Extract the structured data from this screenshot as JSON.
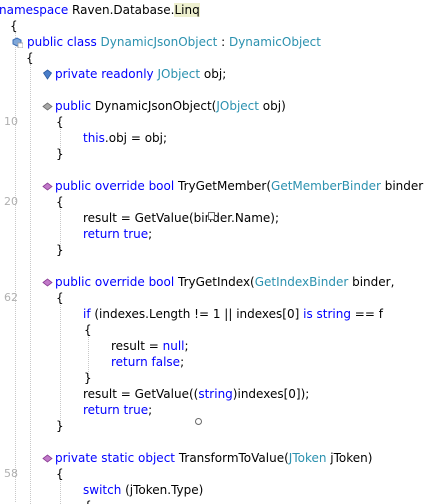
{
  "line_numbers": {
    "ctor": "10",
    "try_get_member": "20",
    "try_get_index": "62",
    "transform": "58"
  },
  "code": {
    "ns_kw": "namespace",
    "ns_name": " Raven.Database.",
    "ns_linq": "Linq",
    "brace_open": "{",
    "brace_close": "}",
    "class_public": "public",
    "class_kw": " class ",
    "class_name": "DynamicJsonObject",
    "class_colon": " : ",
    "class_base": "DynamicObject",
    "field_private": "private",
    "field_readonly": " readonly ",
    "field_type": "JObject",
    "field_name": " obj;",
    "ctor_public": "public",
    "ctor_name": " DynamicJsonObject(",
    "ctor_param_type": "JObject",
    "ctor_param_name": " obj)",
    "ctor_this": "this",
    "ctor_assign": ".obj = obj;",
    "m1_public": "public",
    "m1_override": " override ",
    "m1_bool": "bool",
    "m1_name": " TryGetMember(",
    "m1_param_type": "GetMemberBinder",
    "m1_param_name": " binder",
    "m1_result": "result = GetValue(",
    "m1_binder": "binder.Name);",
    "m1_return": "return",
    "m1_true": " true",
    "semi": ";",
    "m2_public": "public",
    "m2_override": " override ",
    "m2_bool": "bool",
    "m2_name": " TryGetIndex(",
    "m2_param_type": "GetIndexBinder",
    "m2_param_name": " binder,",
    "m2_if": "if",
    "m2_cond": " (indexes.Length != 1 || indexes[0] ",
    "m2_is": "is",
    "m2_string": " string",
    "m2_cond_end": " == f",
    "m2_result_null_a": "result = ",
    "m2_null": "null",
    "m2_return": "return",
    "m2_false": " false",
    "m2_result_b": "result = GetValue((",
    "m2_cast": "string",
    "m2_result_b_end": ")indexes[0]);",
    "m2_return2": "return",
    "m2_true": " true",
    "m3_private": "private",
    "m3_static": " static ",
    "m3_object": "object",
    "m3_name": " TransformToValue(",
    "m3_param_type": "JToken",
    "m3_param_name": " jToken)",
    "m3_switch": "switch",
    "m3_switch_rest": " (jToken.Type)"
  },
  "colors": {
    "keyword": "#0000ff",
    "type": "#2b91af",
    "text": "#000000",
    "linenum": "#b0b0b0"
  }
}
